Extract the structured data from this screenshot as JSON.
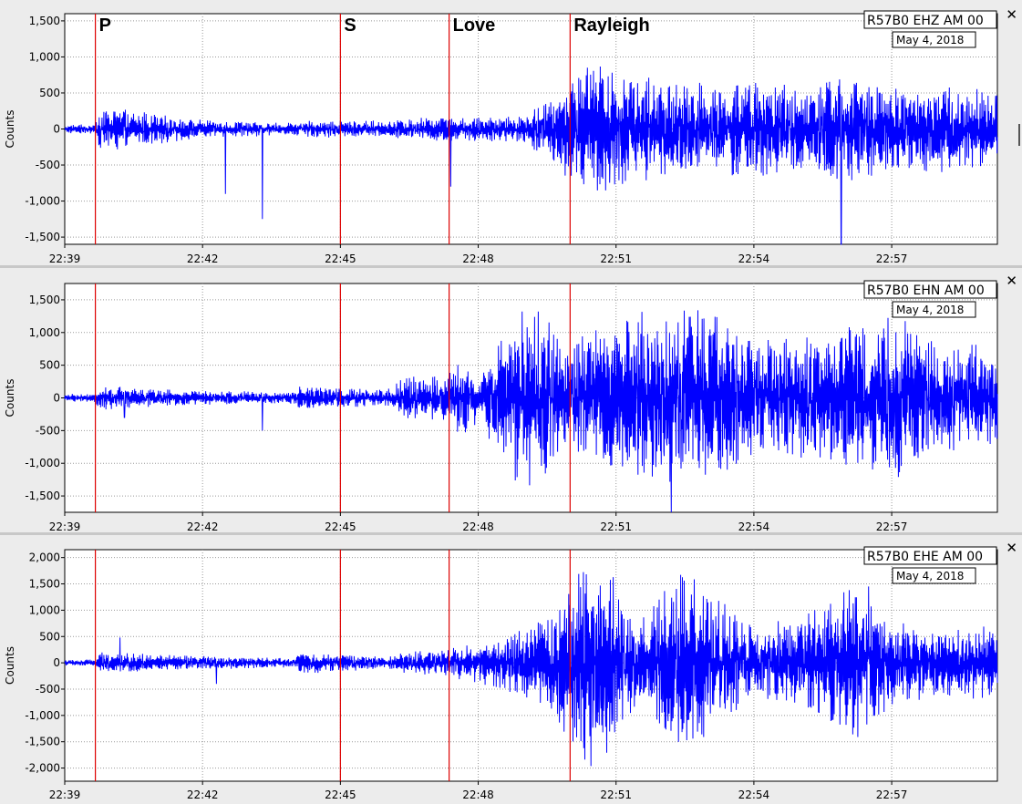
{
  "chart_data": [
    {
      "type": "line",
      "station_label": "R57B0 EHZ AM 00",
      "date_label": "May 4, 2018",
      "ylabel": "Counts",
      "xlabel": "",
      "x_ticks": [
        "22:39",
        "22:42",
        "22:45",
        "22:48",
        "22:51",
        "22:54",
        "22:57"
      ],
      "x_range_minutes": [
        0,
        20.3
      ],
      "ylim": [
        -1600,
        1600
      ],
      "y_ticks": [
        1500,
        1000,
        500,
        0,
        -500,
        -1000,
        -1500
      ],
      "y_tick_labels": [
        "1,500",
        "1,000",
        "500",
        "0",
        "-500",
        "-1,000",
        "-1,500"
      ],
      "phase_markers": [
        {
          "label": "P",
          "t": "22:39:40"
        },
        {
          "label": "S",
          "t": "22:45:00"
        },
        {
          "label": "Love",
          "t": "22:47:22"
        },
        {
          "label": "Rayleigh",
          "t": "22:50:00"
        }
      ],
      "envelope": [
        [
          0,
          60
        ],
        [
          0.65,
          70
        ],
        [
          0.8,
          380
        ],
        [
          1.5,
          260
        ],
        [
          3,
          130
        ],
        [
          5,
          90
        ],
        [
          5.3,
          120
        ],
        [
          7,
          120
        ],
        [
          8,
          170
        ],
        [
          10,
          180
        ],
        [
          11.5,
          1000
        ],
        [
          12.5,
          800
        ],
        [
          13.5,
          650
        ],
        [
          14.5,
          700
        ],
        [
          16,
          650
        ],
        [
          16.7,
          750
        ],
        [
          17,
          800
        ],
        [
          18,
          600
        ],
        [
          19.5,
          600
        ],
        [
          20.3,
          550
        ]
      ],
      "spikes": [
        [
          3.5,
          1050
        ],
        [
          3.5,
          -900
        ],
        [
          4.3,
          1050
        ],
        [
          4.3,
          -1250
        ],
        [
          8.4,
          600
        ],
        [
          8.4,
          -800
        ],
        [
          16.9,
          1500
        ],
        [
          16.9,
          -1600
        ],
        [
          20.2,
          -250
        ]
      ],
      "grid": true,
      "series_color": "#0000ff",
      "marker_color": "#dd0000"
    },
    {
      "type": "line",
      "station_label": "R57B0 EHN AM 00",
      "date_label": "May 4, 2018",
      "ylabel": "Counts",
      "xlabel": "",
      "x_ticks": [
        "22:39",
        "22:42",
        "22:45",
        "22:48",
        "22:51",
        "22:54",
        "22:57"
      ],
      "x_range_minutes": [
        0,
        20.3
      ],
      "ylim": [
        -1750,
        1750
      ],
      "y_ticks": [
        1500,
        1000,
        500,
        0,
        -500,
        -1000,
        -1500
      ],
      "y_tick_labels": [
        "1,500",
        "1,000",
        "500",
        "0",
        "-500",
        "-1,000",
        "-1,500"
      ],
      "phase_markers": [
        {
          "label": "P",
          "t": "22:39:40"
        },
        {
          "label": "S",
          "t": "22:45:00"
        },
        {
          "label": "Love",
          "t": "22:47:22"
        },
        {
          "label": "Rayleigh",
          "t": "22:50:00"
        }
      ],
      "envelope": [
        [
          0,
          60
        ],
        [
          0.65,
          70
        ],
        [
          0.8,
          200
        ],
        [
          1.5,
          150
        ],
        [
          3,
          110
        ],
        [
          5,
          90
        ],
        [
          5.1,
          180
        ],
        [
          7,
          130
        ],
        [
          7.4,
          350
        ],
        [
          8.3,
          350
        ],
        [
          8.6,
          600
        ],
        [
          9,
          400
        ],
        [
          9.8,
          1300
        ],
        [
          10.3,
          1500
        ],
        [
          11,
          900
        ],
        [
          12,
          1200
        ],
        [
          13,
          1500
        ],
        [
          14,
          1500
        ],
        [
          15,
          900
        ],
        [
          16,
          1000
        ],
        [
          17,
          1100
        ],
        [
          18,
          1300
        ],
        [
          19,
          900
        ],
        [
          20.3,
          800
        ]
      ],
      "spikes": [
        [
          1.3,
          -300
        ],
        [
          4.3,
          -500
        ],
        [
          13.2,
          1750
        ],
        [
          13.2,
          -1750
        ]
      ],
      "grid": true,
      "series_color": "#0000ff",
      "marker_color": "#dd0000"
    },
    {
      "type": "line",
      "station_label": "R57B0 EHE AM 00",
      "date_label": "May 4, 2018",
      "ylabel": "Counts",
      "xlabel": "",
      "x_ticks": [
        "22:39",
        "22:42",
        "22:45",
        "22:48",
        "22:51",
        "22:54",
        "22:57"
      ],
      "x_range_minutes": [
        0,
        20.3
      ],
      "ylim": [
        -2250,
        2150
      ],
      "y_ticks": [
        2000,
        1500,
        1000,
        500,
        0,
        -500,
        -1000,
        -1500,
        -2000
      ],
      "y_tick_labels": [
        "2,000",
        "1,500",
        "1,000",
        "500",
        "0",
        "-500",
        "-1,000",
        "-1,500",
        "-2,000"
      ],
      "phase_markers": [
        {
          "label": "P",
          "t": "22:39:40"
        },
        {
          "label": "S",
          "t": "22:45:00"
        },
        {
          "label": "Love",
          "t": "22:47:22"
        },
        {
          "label": "Rayleigh",
          "t": "22:50:00"
        }
      ],
      "envelope": [
        [
          0,
          60
        ],
        [
          0.65,
          70
        ],
        [
          0.8,
          200
        ],
        [
          1.5,
          180
        ],
        [
          3,
          130
        ],
        [
          5,
          90
        ],
        [
          5.1,
          230
        ],
        [
          7,
          110
        ],
        [
          7.4,
          200
        ],
        [
          8.5,
          300
        ],
        [
          9.5,
          500
        ],
        [
          10.5,
          900
        ],
        [
          11.3,
          2100
        ],
        [
          11.8,
          1900
        ],
        [
          12.4,
          900
        ],
        [
          13.5,
          1800
        ],
        [
          14.3,
          1200
        ],
        [
          15,
          700
        ],
        [
          16,
          900
        ],
        [
          17.2,
          1500
        ],
        [
          18,
          800
        ],
        [
          19,
          700
        ],
        [
          20.3,
          700
        ]
      ],
      "spikes": [
        [
          1.2,
          480
        ],
        [
          3.3,
          -400
        ],
        [
          17.5,
          1450
        ]
      ],
      "grid": true,
      "series_color": "#0000ff",
      "marker_color": "#dd0000"
    }
  ]
}
